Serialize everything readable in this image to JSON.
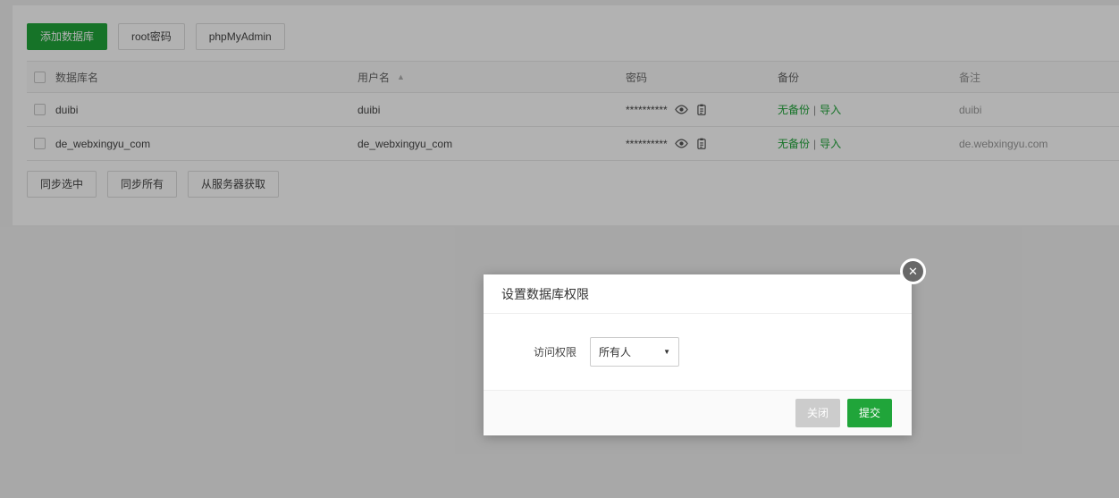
{
  "toolbar": {
    "add_db": "添加数据库",
    "root_pwd": "root密码",
    "phpmyadmin": "phpMyAdmin"
  },
  "table": {
    "headers": {
      "name": "数据库名",
      "user": "用户名",
      "password": "密码",
      "backup": "备份",
      "note": "备注"
    },
    "sort_icon": "▲",
    "rows": [
      {
        "name": "duibi",
        "user": "duibi",
        "password": "**********",
        "backup_link": "无备份",
        "separator": "|",
        "import_link": "导入",
        "note": "duibi"
      },
      {
        "name": "de_webxingyu_com",
        "user": "de_webxingyu_com",
        "password": "**********",
        "backup_link": "无备份",
        "separator": "|",
        "import_link": "导入",
        "note": "de.webxingyu.com"
      }
    ]
  },
  "actions": {
    "sync_selected": "同步选中",
    "sync_all": "同步所有",
    "get_from_server": "从服务器获取"
  },
  "modal": {
    "title": "设置数据库权限",
    "access_label": "访问权限",
    "access_value": "所有人",
    "select_arrow": "▼",
    "close_icon": "✕",
    "close_button": "关闭",
    "submit_button": "提交"
  },
  "colors": {
    "accent_green": "#20a53a",
    "close_button_gray": "#cccccc",
    "overlay": "rgba(0,0,0,0.30)"
  }
}
